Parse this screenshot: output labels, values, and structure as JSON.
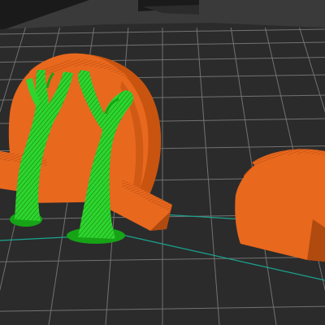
{
  "viewport": {
    "type": "slicer-3d-preview",
    "colors": {
      "background": "#1a1a1a",
      "bed_surface": "#2a2a2a",
      "bed_frame": "#3a3a3a",
      "grid_line": "#8a8a8a",
      "object_orange": "#e8681e",
      "object_orange_shade": "#c85410",
      "object_orange_dark": "#a8420a",
      "support_green": "#2ed52e",
      "support_green_shade": "#16a316",
      "travel_line": "#1aa590"
    },
    "objects": [
      {
        "name": "disc-with-tree-supports",
        "kind": "model"
      },
      {
        "name": "half-disc",
        "kind": "model"
      }
    ],
    "supports": {
      "style": "tree",
      "count": 2
    }
  }
}
